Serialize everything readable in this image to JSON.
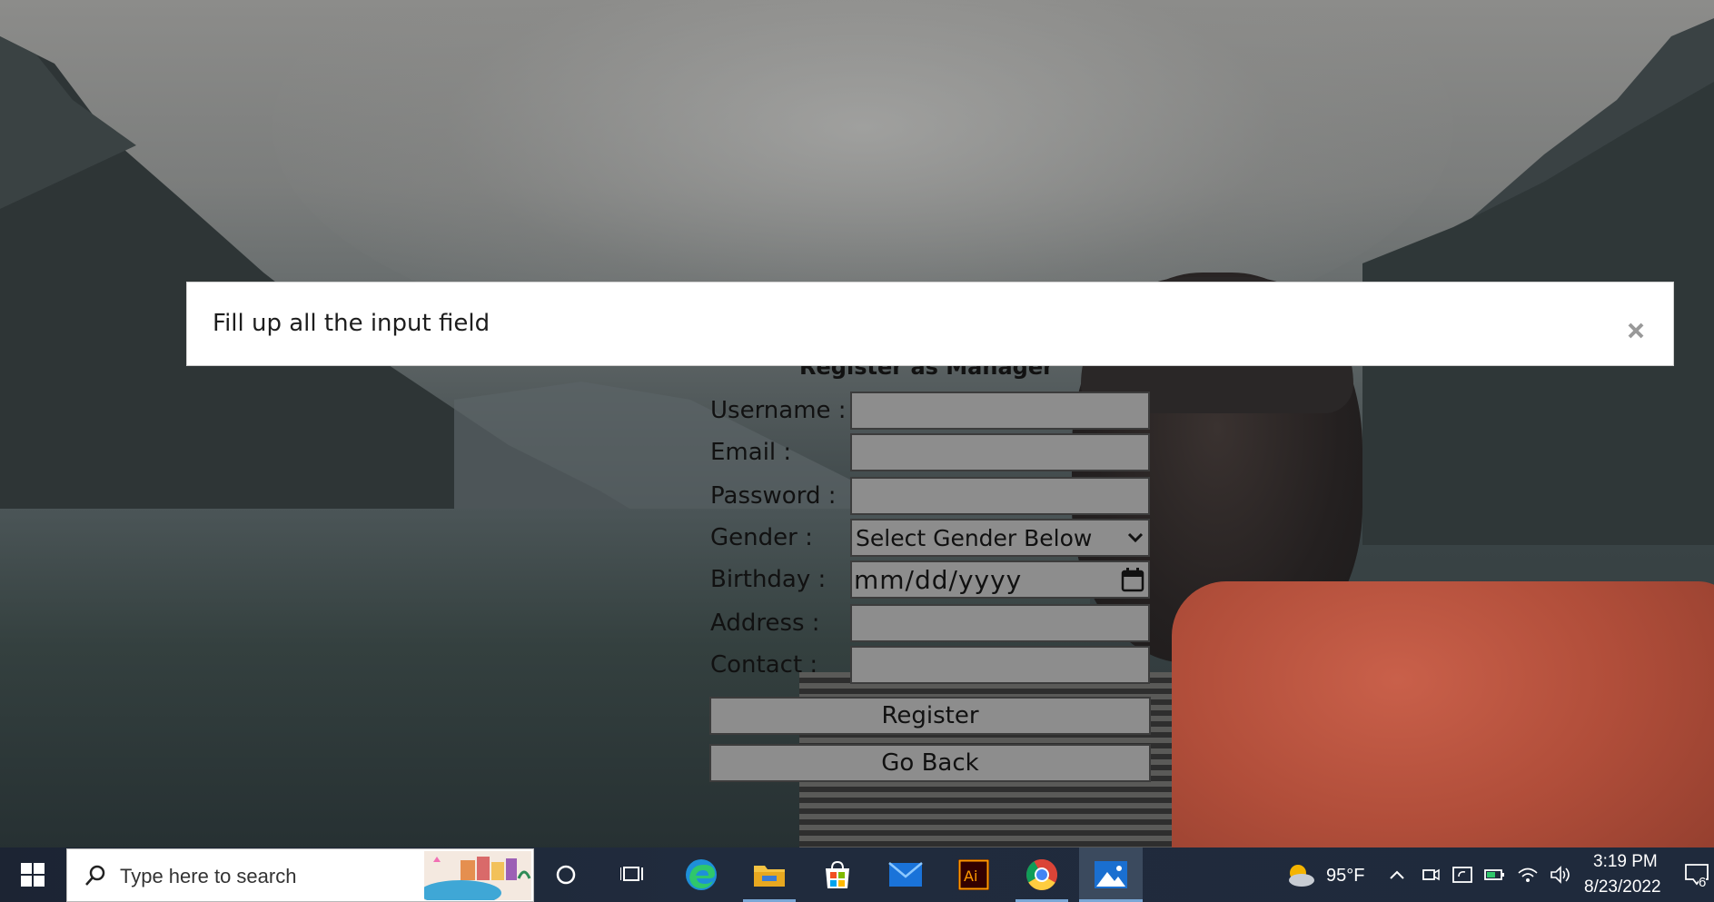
{
  "alert": {
    "message": "Fill up all the input field"
  },
  "form": {
    "title": "Register as Manager",
    "fields": [
      {
        "label": "Username :",
        "value": ""
      },
      {
        "label": "Email :",
        "value": ""
      },
      {
        "label": "Password :",
        "value": ""
      },
      {
        "label": "Gender :",
        "value": "Select Gender Below"
      },
      {
        "label": "Birthday :",
        "value": "mm/dd/yyyy"
      },
      {
        "label": "Address :",
        "value": ""
      },
      {
        "label": "Contact :",
        "value": ""
      }
    ],
    "register_label": "Register",
    "goback_label": "Go Back"
  },
  "taskbar": {
    "search_placeholder": "Type here to search",
    "weather_temp": "95°F",
    "time": "3:19 PM",
    "date": "8/23/2022",
    "notification_count": "6",
    "apps": [
      "start-icon",
      "cortana-icon",
      "task-view-icon",
      "edge-icon",
      "file-explorer-icon",
      "microsoft-store-icon",
      "mail-icon",
      "illustrator-icon",
      "chrome-icon",
      "photos-icon"
    ]
  },
  "colors": {
    "field_bg": "#8d8d8d",
    "taskbar_bg": "#1f2a3a",
    "alert_bg": "#ffffff"
  }
}
